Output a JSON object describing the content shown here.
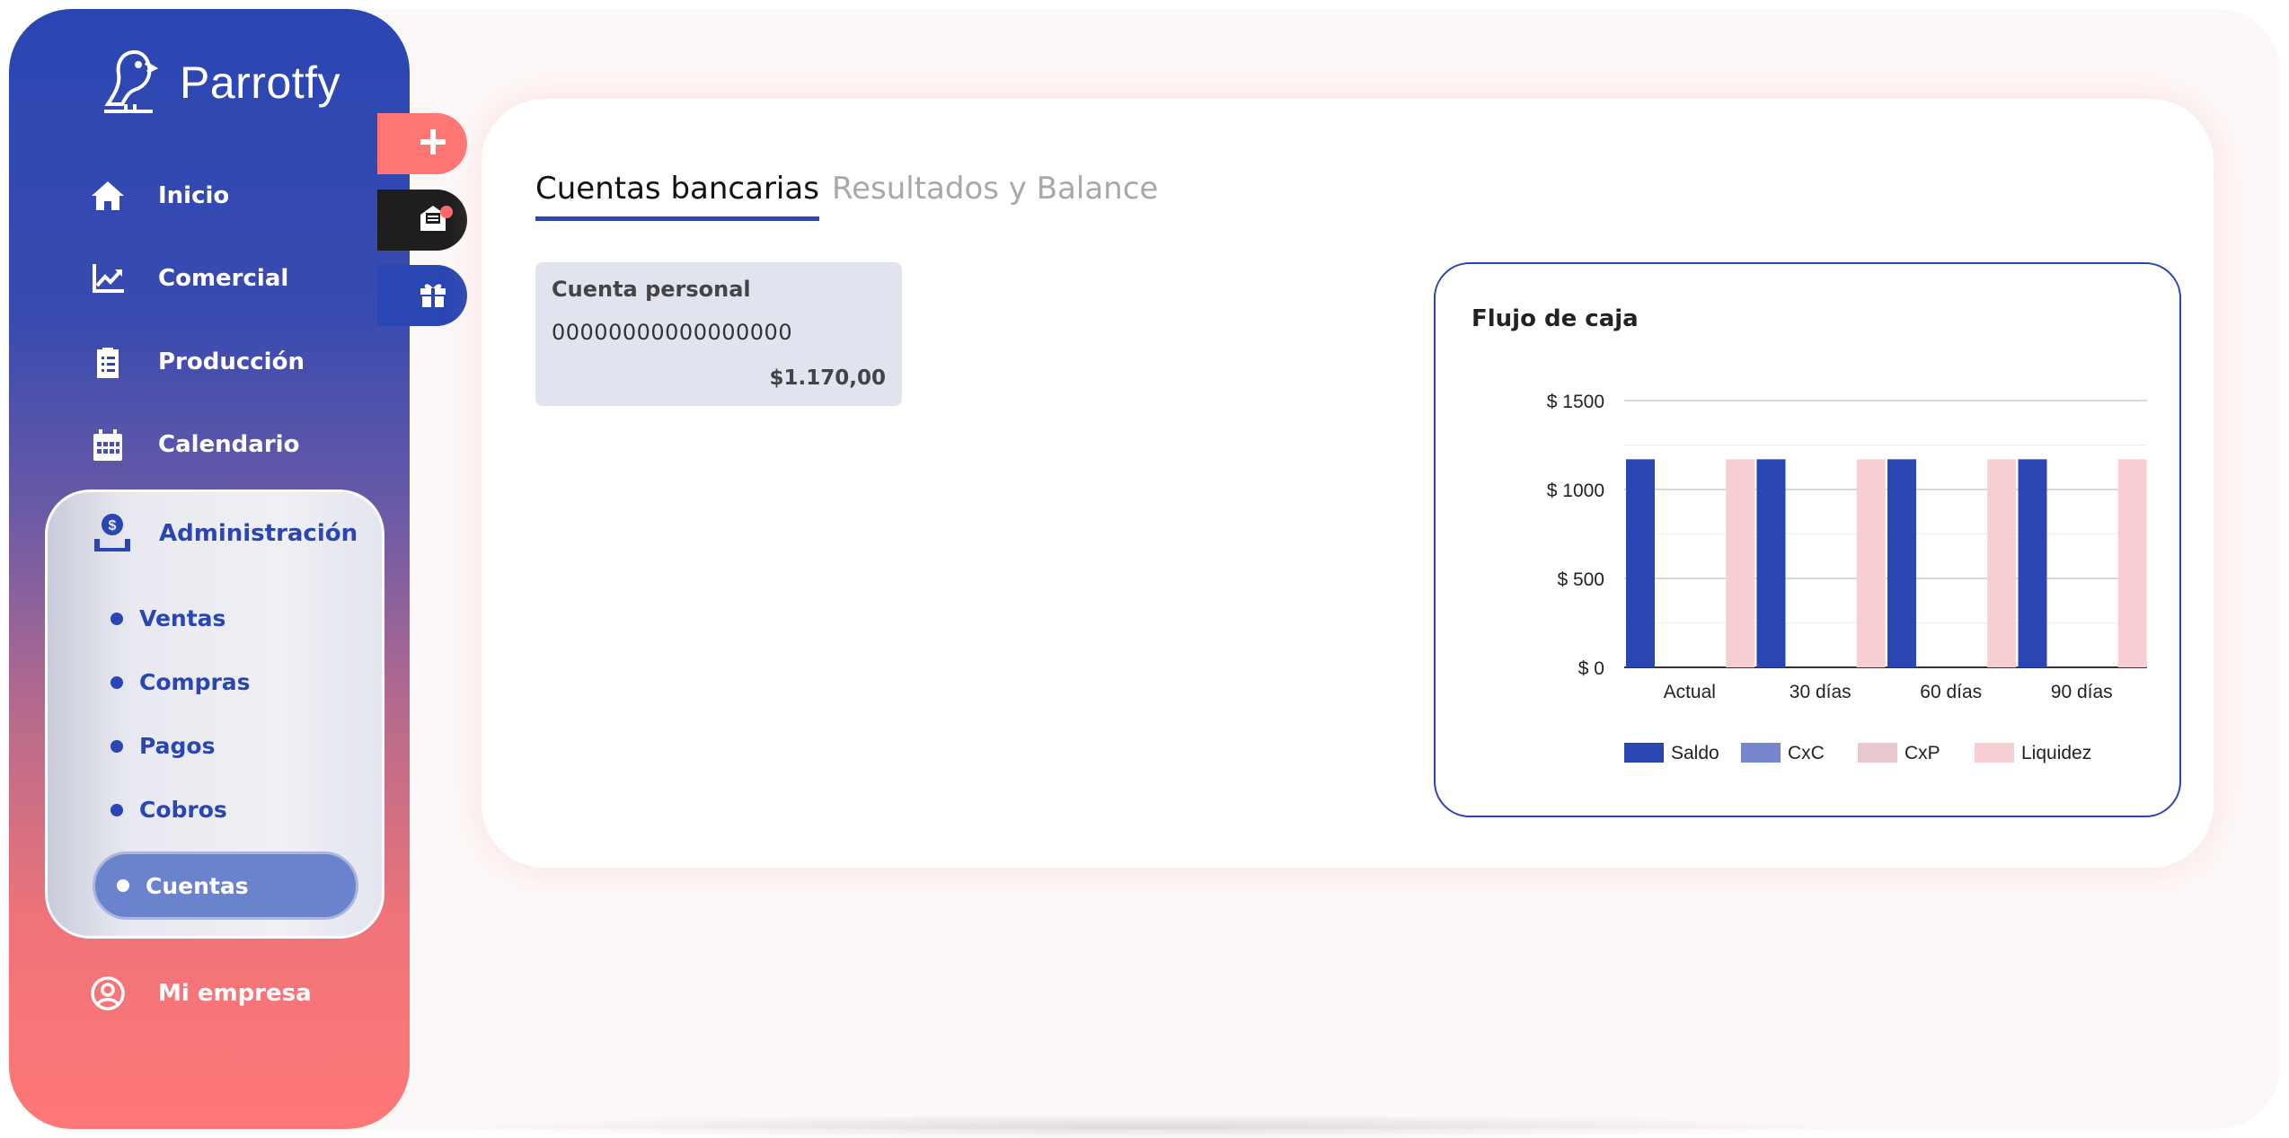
{
  "app": {
    "name": "Parrotfy"
  },
  "sidebar": {
    "items": [
      {
        "label": "Inicio",
        "icon": "home-icon"
      },
      {
        "label": "Comercial",
        "icon": "chart-line-icon"
      },
      {
        "label": "Producción",
        "icon": "clipboard-icon"
      },
      {
        "label": "Calendario",
        "icon": "calendar-icon"
      }
    ],
    "admin": {
      "label": "Administración",
      "icon": "money-hand-icon",
      "subitems": [
        "Ventas",
        "Compras",
        "Pagos",
        "Cobros",
        "Cuentas"
      ],
      "active": "Cuentas"
    },
    "bottom": {
      "label": "Mi empresa",
      "icon": "user-circle-icon"
    }
  },
  "fabs": [
    {
      "name": "add",
      "icon": "plus-icon",
      "color": "#ff7675"
    },
    {
      "name": "messages",
      "icon": "mail-icon",
      "color": "#1e1e1e"
    },
    {
      "name": "gift",
      "icon": "gift-icon",
      "color": "#2a46b3"
    }
  ],
  "tabs": [
    {
      "label": "Cuentas bancarias",
      "active": true
    },
    {
      "label": "Resultados y Balance",
      "active": false
    }
  ],
  "account": {
    "name": "Cuenta personal",
    "number": "00000000000000000",
    "balance": "$1.170,00"
  },
  "colors": {
    "primary": "#2a46b3",
    "accent": "#ff7675",
    "saldo": "#2a46b3",
    "cxc": "#7686cc",
    "cxp": "#e8c8cc",
    "liquidez": "#f7cfd2"
  },
  "chart_data": {
    "type": "bar",
    "title": "Flujo de caja",
    "categories": [
      "Actual",
      "30 días",
      "60 días",
      "90 días"
    ],
    "series": [
      {
        "name": "Saldo",
        "values": [
          1170,
          1170,
          1170,
          1170
        ]
      },
      {
        "name": "CxC",
        "values": [
          0,
          0,
          0,
          0
        ]
      },
      {
        "name": "CxP",
        "values": [
          0,
          0,
          0,
          0
        ]
      },
      {
        "name": "Liquidez",
        "values": [
          1170,
          1170,
          1170,
          1170
        ]
      }
    ],
    "y_ticks": [
      "$ 0",
      "$ 500",
      "$ 1000",
      "$ 1500"
    ],
    "ylim": [
      0,
      1500
    ],
    "legend": "bottom",
    "grid": true
  }
}
